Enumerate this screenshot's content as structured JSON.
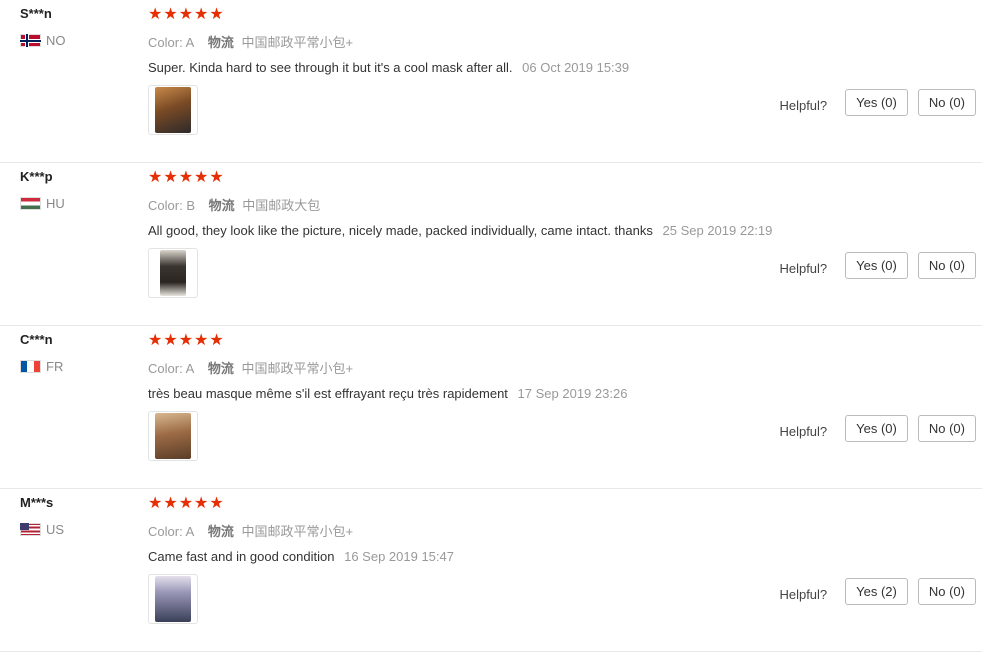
{
  "reviews": [
    {
      "name": "S***n",
      "country": "NO",
      "flag": "norway",
      "stars": "★★★★★",
      "color_label": "Color:",
      "color_value": "A",
      "ship_label": "物流",
      "ship_value": "中国邮政平常小包+",
      "text": "Super. Kinda hard to see through it but it's a cool mask after all.",
      "date": "06 Oct 2019 15:39",
      "helpful_label": "Helpful?",
      "yes": "Yes (0)",
      "no": "No (0)",
      "thumb_color": "#8b5a2b"
    },
    {
      "name": "K***p",
      "country": "HU",
      "flag": "hungary",
      "stars": "★★★★★",
      "color_label": "Color:",
      "color_value": "B",
      "ship_label": "物流",
      "ship_value": "中国邮政大包",
      "text": "All good, they look like the picture, nicely made, packed individually, came intact. thanks",
      "date": "25 Sep 2019 22:19",
      "helpful_label": "Helpful?",
      "yes": "Yes (0)",
      "no": "No (0)",
      "thumb_color": "#3a3530"
    },
    {
      "name": "C***n",
      "country": "FR",
      "flag": "france",
      "stars": "★★★★★",
      "color_label": "Color:",
      "color_value": "A",
      "ship_label": "物流",
      "ship_value": "中国邮政平常小包+",
      "text": "très beau masque même s'il est effrayant reçu très rapidement",
      "date": "17 Sep 2019 23:26",
      "helpful_label": "Helpful?",
      "yes": "Yes (0)",
      "no": "No (0)",
      "thumb_color": "#9c6b45"
    },
    {
      "name": "M***s",
      "country": "US",
      "flag": "usa",
      "stars": "★★★★★",
      "color_label": "Color:",
      "color_value": "A",
      "ship_label": "物流",
      "ship_value": "中国邮政平常小包+",
      "text": "Came fast and in good condition",
      "date": "16 Sep 2019 15:47",
      "helpful_label": "Helpful?",
      "yes": "Yes (2)",
      "no": "No (0)",
      "thumb_color": "#6f7f9a"
    }
  ]
}
